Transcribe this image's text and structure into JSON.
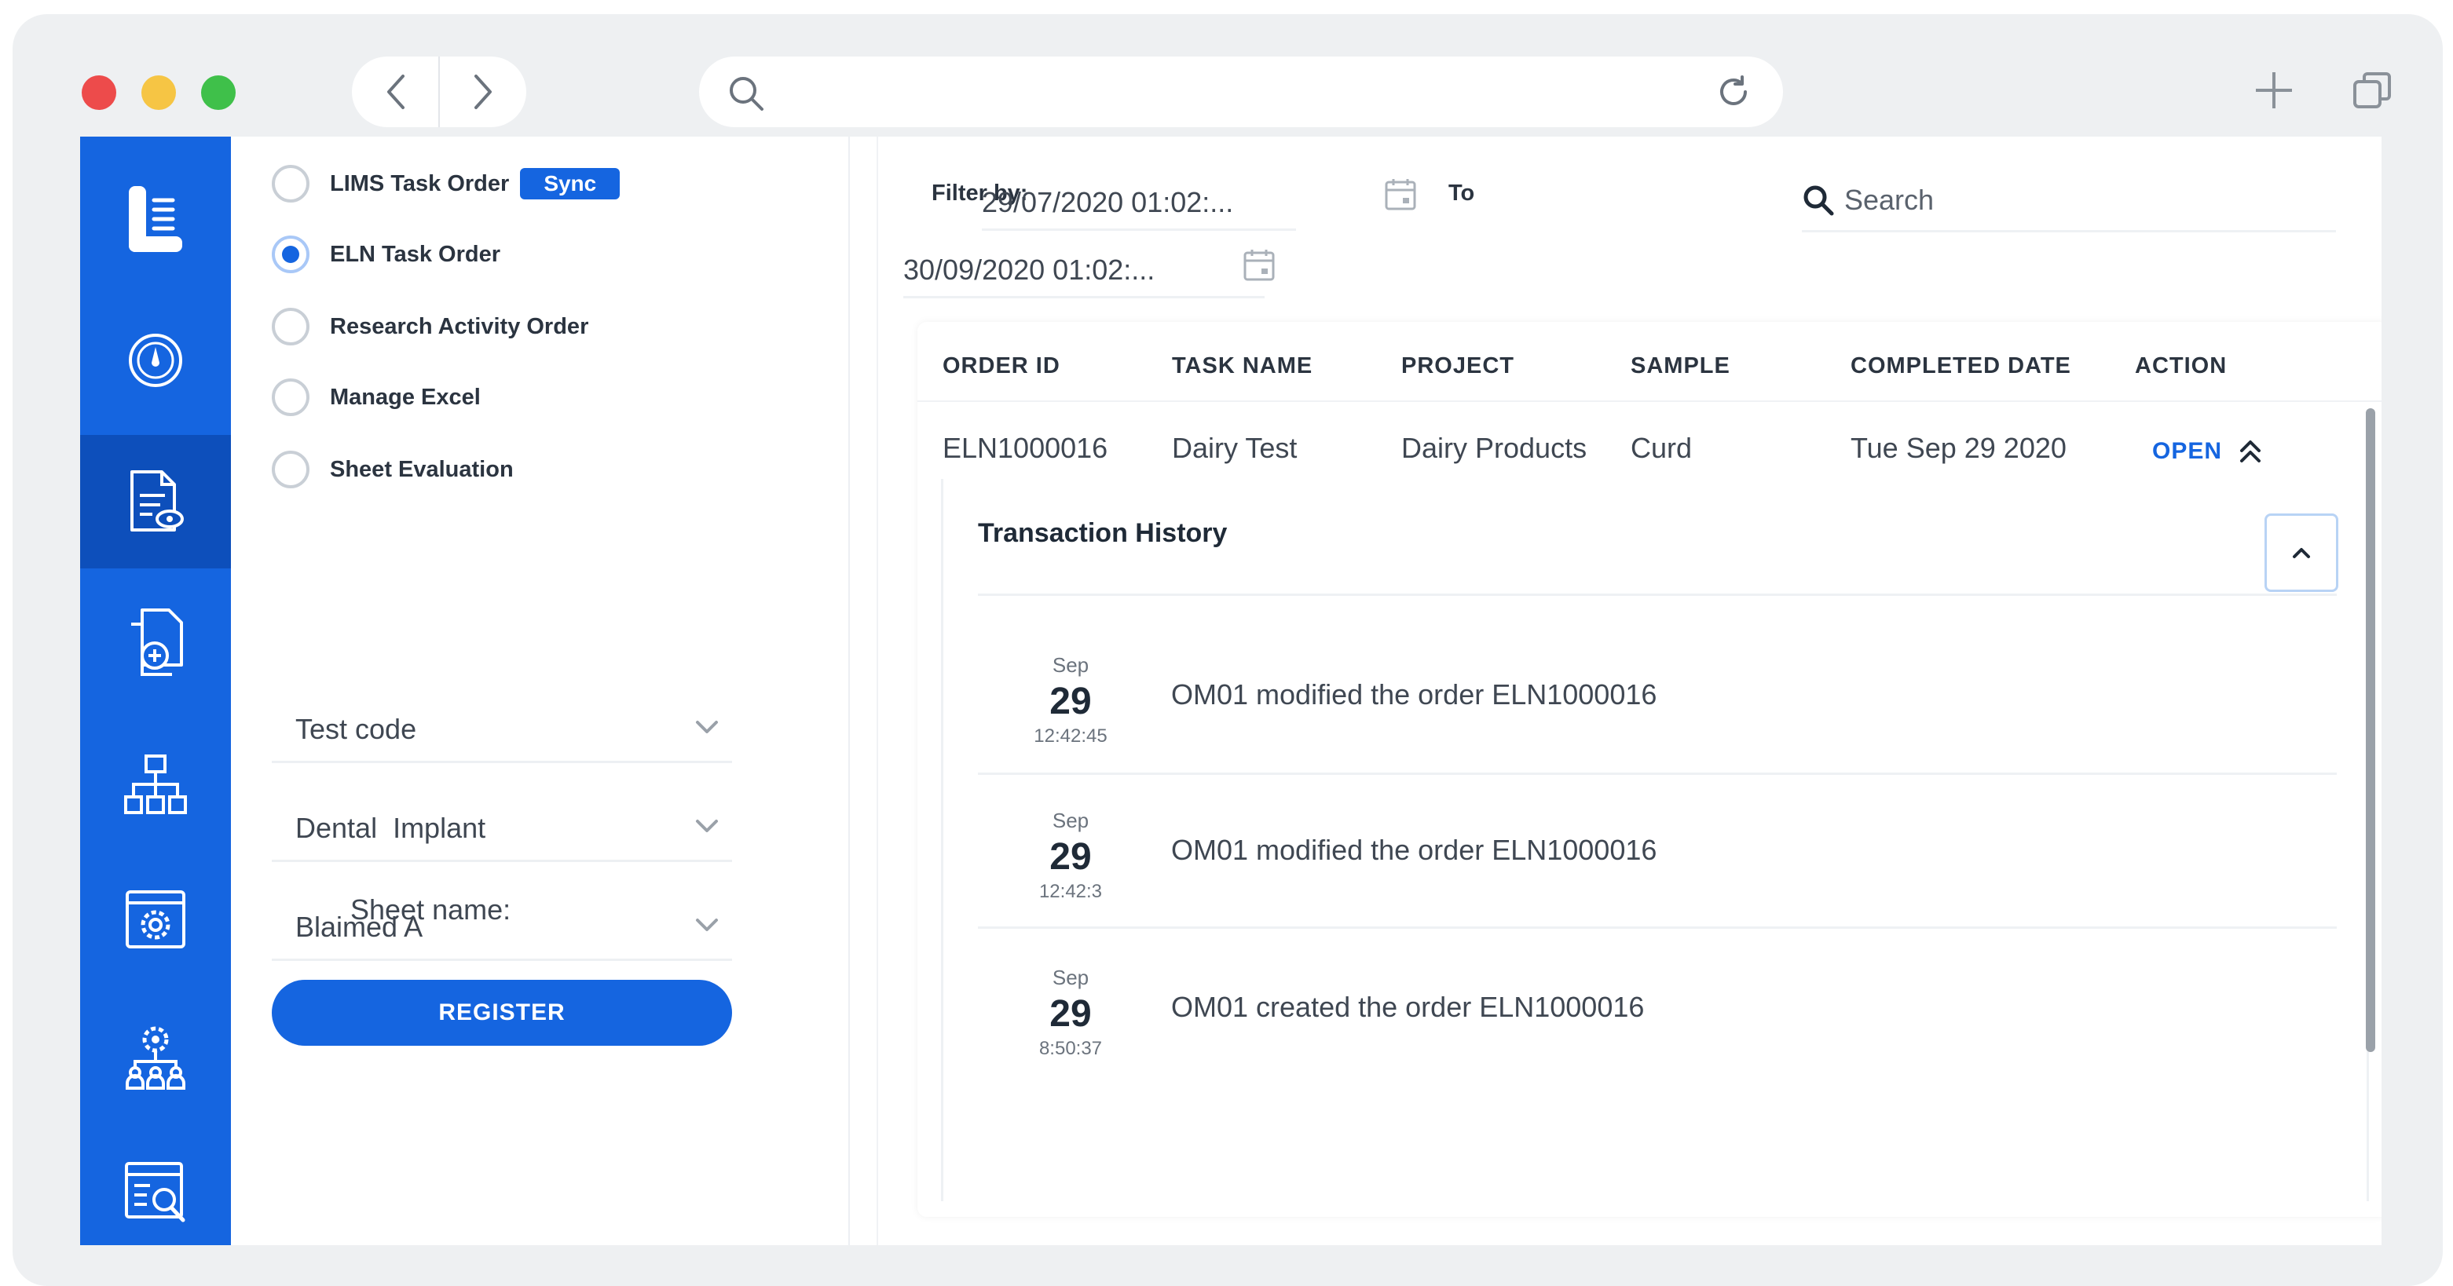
{
  "browser": {
    "colors": {
      "red": "#ed4b4b",
      "yellow": "#f6c544",
      "green": "#3fc04a"
    },
    "url_value": ""
  },
  "rail": {
    "items": [
      {
        "icon": "logo-list-icon"
      },
      {
        "icon": "dashboard-gauge-icon"
      },
      {
        "icon": "document-view-icon",
        "active": true
      },
      {
        "icon": "document-add-icon"
      },
      {
        "icon": "hierarchy-icon"
      },
      {
        "icon": "settings-window-icon"
      },
      {
        "icon": "team-settings-icon"
      },
      {
        "icon": "search-report-icon"
      }
    ]
  },
  "panel": {
    "order_types": [
      {
        "label": "LIMS Task Order",
        "selected": false
      },
      {
        "label": "ELN Task Order",
        "selected": true
      },
      {
        "label": "Research Activity Order",
        "selected": false
      },
      {
        "label": "Manage Excel",
        "selected": false
      },
      {
        "label": "Sheet Evaluation",
        "selected": false
      }
    ],
    "sync_label": "Sync",
    "selects": [
      {
        "value": "Test code"
      },
      {
        "value": "Dental  Implant"
      },
      {
        "value": "Blaimed A"
      }
    ],
    "sheet_name_label": "Sheet name:",
    "register_label": "REGISTER"
  },
  "main": {
    "filter_label": "Filter by:",
    "from_date": "29/07/2020 01:02:...",
    "to_label": "To",
    "to_date": "30/09/2020 01:02:...",
    "search_placeholder": "Search",
    "table": {
      "headers": [
        "ORDER ID",
        "TASK NAME",
        "PROJECT",
        "SAMPLE",
        "COMPLETED DATE",
        "ACTION"
      ],
      "row": {
        "order_id": "ELN1000016",
        "task_name": "Dairy Test",
        "project": "Dairy Products",
        "sample": "Curd",
        "completed_date": "Tue Sep 29 2020",
        "action": "OPEN"
      }
    },
    "history": {
      "title": "Transaction History",
      "events": [
        {
          "month": "Sep",
          "day": "29",
          "time": "12:42:45",
          "text": "OM01 modified the order ELN1000016"
        },
        {
          "month": "Sep",
          "day": "29",
          "time": "12:42:3",
          "text": "OM01 modified the order ELN1000016"
        },
        {
          "month": "Sep",
          "day": "29",
          "time": "8:50:37",
          "text": "OM01 created the order ELN1000016"
        }
      ]
    }
  }
}
